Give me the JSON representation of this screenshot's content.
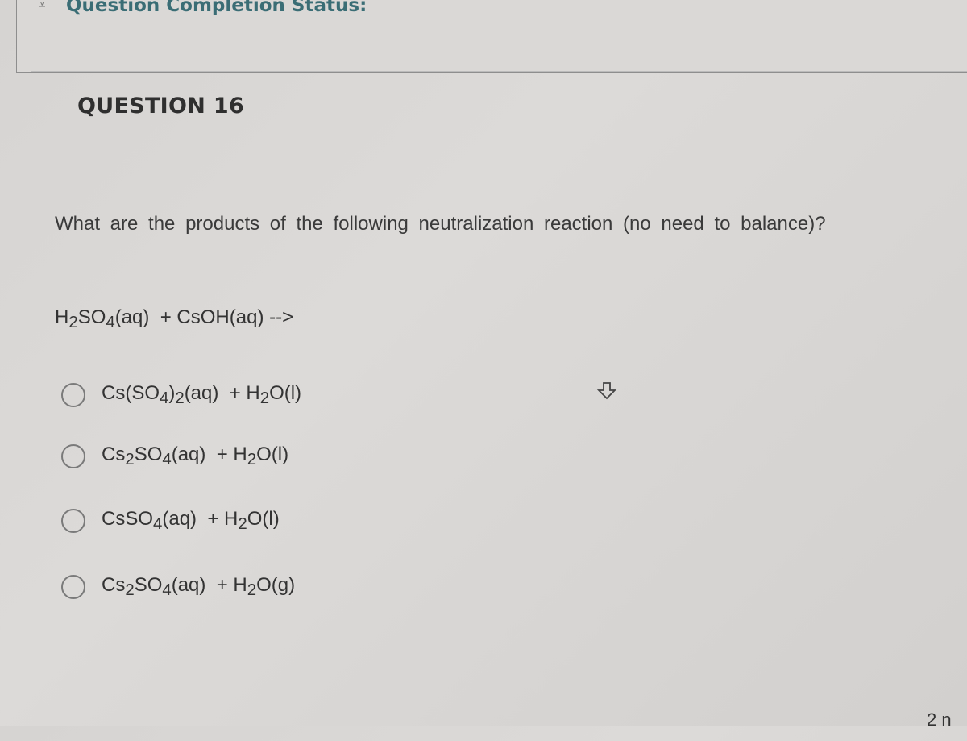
{
  "status": {
    "chevron_icon": "double-chevron-down",
    "title": "Question Completion Status:"
  },
  "question": {
    "number_label": "QUESTION 16",
    "prompt": "What are the products of the following neutralization reaction (no need to balance)?",
    "reaction": {
      "lhs": [
        "H",
        "2",
        "SO",
        "4",
        "(aq)  + CsOH(aq) -->"
      ]
    },
    "options": [
      {
        "parts": [
          "Cs(SO",
          "4",
          ")",
          "2",
          "(aq)  + H",
          "2",
          "O(l)"
        ],
        "selected": false
      },
      {
        "parts": [
          "Cs",
          "2",
          "SO",
          "4",
          "(aq)  + H",
          "2",
          "O(l)"
        ],
        "selected": false
      },
      {
        "parts": [
          "CsSO",
          "4",
          "(aq)  + H",
          "2",
          "O(l)"
        ],
        "selected": false
      },
      {
        "parts": [
          "Cs",
          "2",
          "SO",
          "4",
          "(aq)  + H",
          "2",
          "O(g)"
        ],
        "selected": false
      }
    ]
  },
  "corner_text": "2 n"
}
